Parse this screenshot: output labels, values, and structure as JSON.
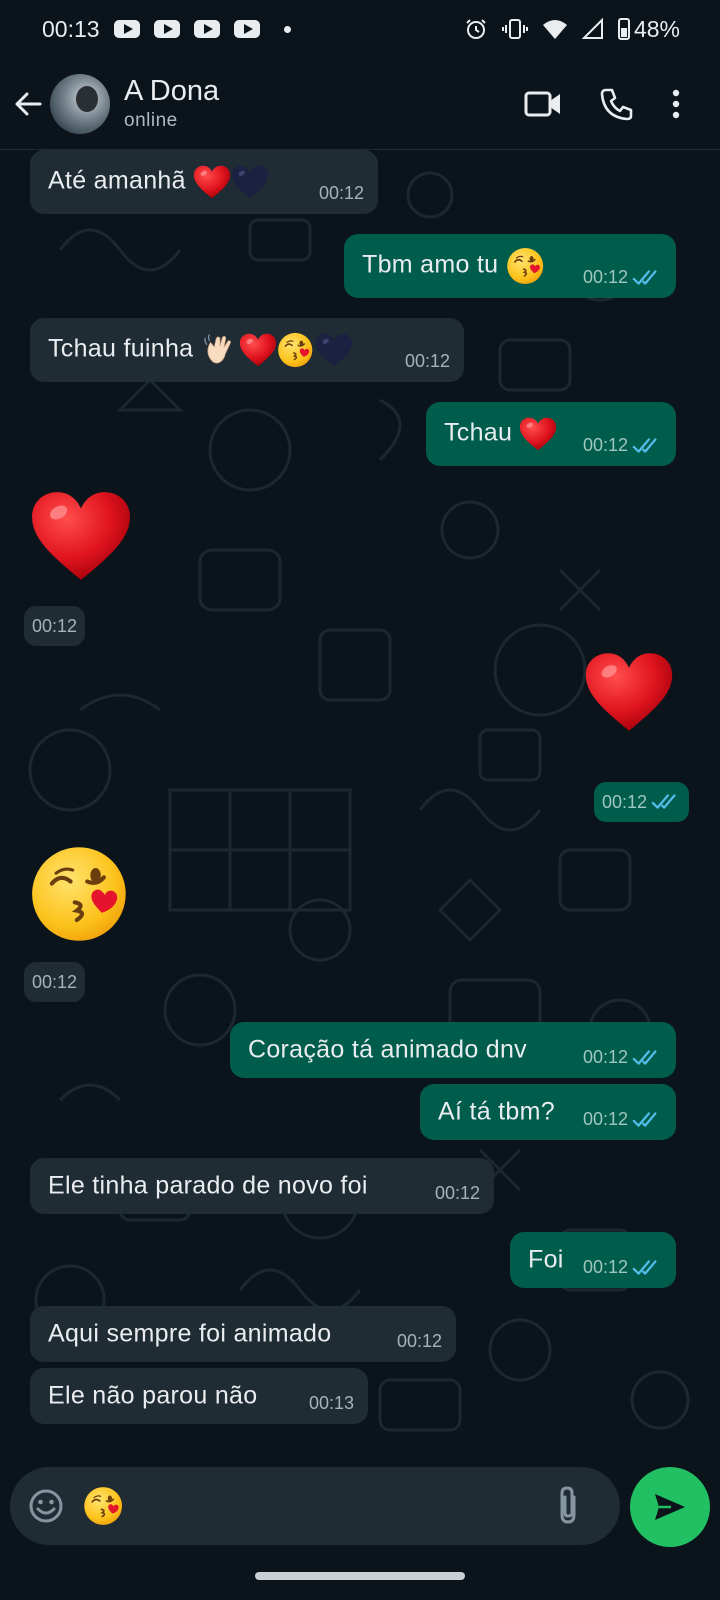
{
  "status_bar": {
    "time": "00:13",
    "notification_icons": [
      "youtube-icon",
      "youtube-icon",
      "youtube-icon",
      "youtube-icon"
    ],
    "battery": "48%"
  },
  "header": {
    "contact_name": "A Dona",
    "contact_status": "online"
  },
  "messages": [
    {
      "direction": "in",
      "text": "Até amanhã",
      "emoji": [
        "❤️",
        "🖤"
      ],
      "time": "00:12"
    },
    {
      "direction": "out",
      "text": "Tbm amo tu",
      "emoji": [
        "😘"
      ],
      "time": "00:12",
      "read": true
    },
    {
      "direction": "in",
      "text": "Tchau fuinha",
      "emoji": [
        "👋",
        "❤️",
        "😘",
        "🖤"
      ],
      "time": "00:12"
    },
    {
      "direction": "out",
      "text": "Tchau",
      "emoji": [
        "❤️"
      ],
      "time": "00:12",
      "read": true
    },
    {
      "direction": "in",
      "text": "",
      "emoji": [
        "❤️"
      ],
      "time": "00:12",
      "big_emoji": true
    },
    {
      "direction": "out",
      "text": "",
      "emoji": [
        "❤️"
      ],
      "time": "00:12",
      "big_emoji": true,
      "read": true
    },
    {
      "direction": "in",
      "text": "",
      "emoji": [
        "😘"
      ],
      "time": "00:12",
      "big_emoji": true
    },
    {
      "direction": "out",
      "text": "Coração tá animado dnv",
      "time": "00:12",
      "read": true
    },
    {
      "direction": "out",
      "text": "Aí tá tbm?",
      "time": "00:12",
      "read": true
    },
    {
      "direction": "in",
      "text": "Ele tinha parado de novo foi",
      "time": "00:12"
    },
    {
      "direction": "out",
      "text": "Foi",
      "time": "00:12",
      "read": true
    },
    {
      "direction": "in",
      "text": "Aqui sempre foi animado",
      "time": "00:12"
    },
    {
      "direction": "in",
      "text": "Ele não parou não",
      "time": "00:13"
    }
  ],
  "composer": {
    "draft_emoji": "😘"
  },
  "colors": {
    "background": "#0b141a",
    "incoming_bubble": "#202c33",
    "outgoing_bubble": "#005c4b",
    "read_ticks": "#53bdeb",
    "send_button": "#21c063"
  }
}
